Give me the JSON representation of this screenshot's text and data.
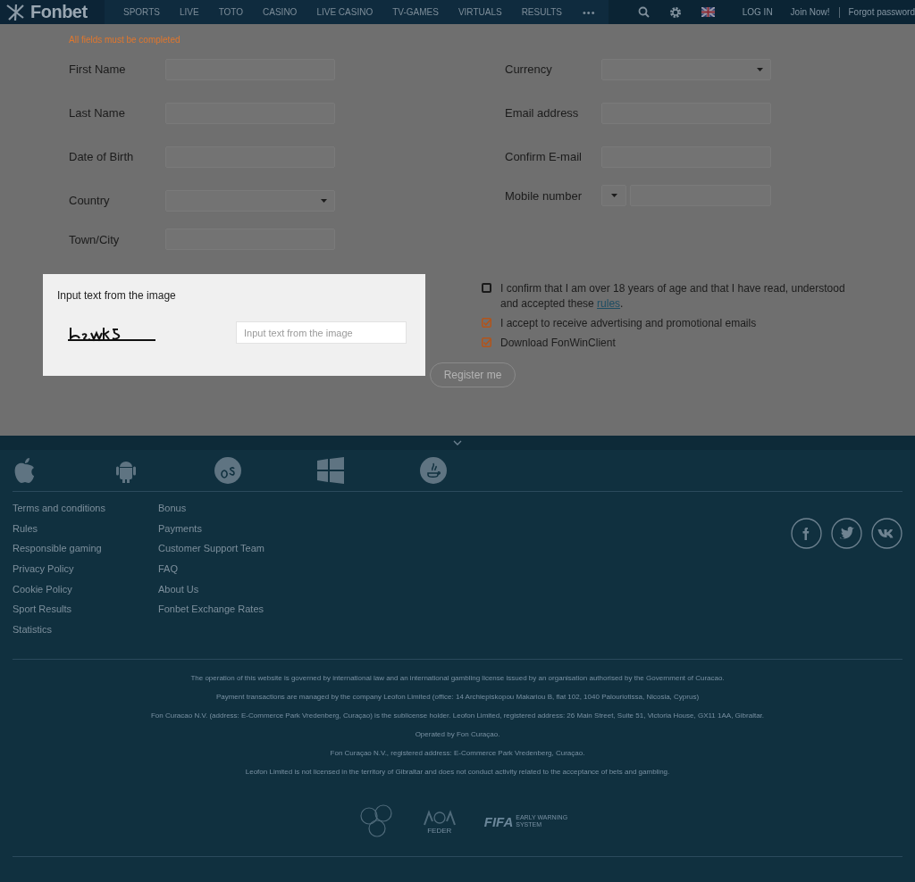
{
  "header": {
    "logo": "Fonbet",
    "nav": [
      "SPORTS",
      "LIVE",
      "TOTO",
      "CASINO",
      "LIVE CASINO",
      "TV-GAMES",
      "VIRTUALS",
      "RESULTS"
    ],
    "more": "•••",
    "login": "LOG IN",
    "join": "Join Now!",
    "forgot": "Forgot password"
  },
  "form": {
    "notice": "All fields must be completed",
    "left_fields": [
      {
        "label": "First Name",
        "kind": "text"
      },
      {
        "label": "Last Name",
        "kind": "text"
      },
      {
        "label": "Date of Birth",
        "kind": "text"
      },
      {
        "label": "Country",
        "kind": "select"
      },
      {
        "label": "Town/City",
        "kind": "text"
      }
    ],
    "right_fields": [
      {
        "label": "Currency",
        "kind": "select"
      },
      {
        "label": "Email address",
        "kind": "text"
      },
      {
        "label": "Confirm E-mail",
        "kind": "text"
      },
      {
        "label": "Mobile number",
        "kind": "phone"
      }
    ]
  },
  "captcha": {
    "label": "Input text from the image",
    "placeholder": "Input text from the image"
  },
  "consents": [
    {
      "text": "I confirm that I am over 18 years of age and that I have read, understood and accepted these ",
      "link": "rules",
      "after": ".",
      "checked": false
    },
    {
      "text": "I accept to receive advertising and promotional emails",
      "checked": true
    },
    {
      "text": "Download FonWinClient",
      "checked": true
    }
  ],
  "register_button": "Register me",
  "footer": {
    "link_columns": [
      [
        "Terms and conditions",
        "Rules",
        "Responsible gaming",
        "Privacy Policy",
        "Cookie Policy",
        "Sport Results",
        "Statistics"
      ],
      [
        "Bonus",
        "Payments",
        "Customer Support Team",
        "FAQ",
        "About Us",
        "Fonbet Exchange Rates"
      ]
    ],
    "legal": [
      "The operation of this website is governed by international law and an international gambling license issued by an organisation authorised by the Government of Curacao.",
      "Payment transactions are managed by the company Leofon Limited (office: 14 Archiepiskopou Makariou B, flat 102, 1040 Palouriotissa, Nicosia, Cyprus)",
      "Fon Curacao N.V. (address: E-Commerce Park Vredenberg, Curaçao) is the sublicense holder.   Leofon Limited, registered address: 26 Main Street, Suite 51, Victoria House, GX11 1AA, Gibraltar.",
      "Operated by Fon Curaçao.",
      "Fon Curaçao N.V., registered address: E-Commerce Park Vredenberg, Curaçao.",
      "Leofon Limited is not licensed in the territory of Gibraltar and  does not conduct activity related to the acceptance of bets and gambling."
    ],
    "partner_feder": "FEDER",
    "partner_fifa": "FIFA",
    "partner_fifa_sub": "EARLY WARNING SYSTEM"
  }
}
